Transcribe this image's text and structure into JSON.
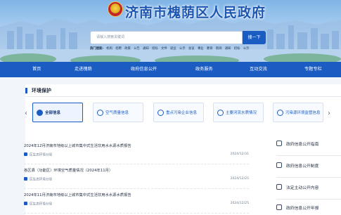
{
  "site": {
    "title": "济南市槐荫区人民政府"
  },
  "search": {
    "placeholder": "请输入搜索关键词",
    "button": "搜一下"
  },
  "hot": {
    "label": "热门搜索:",
    "words": [
      "机构",
      "招聘",
      "政策",
      "公告",
      "通知",
      "招标",
      "文件",
      "就业",
      "公示",
      "会议",
      "事业",
      "教育",
      "新闻",
      "通知",
      "招标",
      "公示"
    ]
  },
  "nav": {
    "items": [
      "首页",
      "走进槐荫",
      "政府信息公开",
      "政务服务",
      "互动交流",
      "专题专栏"
    ]
  },
  "section": {
    "title": "环境保护"
  },
  "categories": [
    {
      "label": "全部信息",
      "active": true
    },
    {
      "label": "空气质量信息",
      "active": false
    },
    {
      "label": "重点污染企业信息",
      "active": false
    },
    {
      "label": "主要河流水质情况",
      "active": false
    },
    {
      "label": "污染源环境监管信息",
      "active": false
    }
  ],
  "articles": [
    {
      "title": "2024年12月济南市地级以上城市集中式生活饮用水水源水质报告",
      "source": "区生态环境分局",
      "date": "2024/12/31"
    },
    {
      "title": "各区县（功能区）环境空气质量情况（2024年11月）",
      "source": "区生态环境分局",
      "date": "2024/12/25"
    },
    {
      "title": "2024年11月济南市地级以上城市集中式生活饮用水水源水质报告",
      "source": "区生态环境分局",
      "date": "2024/12/25"
    }
  ],
  "sidebar": {
    "items": [
      "政府信息公开指南",
      "政府信息公开制度",
      "法定主动公开内容",
      "政府信息公开年报"
    ]
  },
  "colors": {
    "primary": "#1b5cc2",
    "title": "#1c56b0"
  }
}
